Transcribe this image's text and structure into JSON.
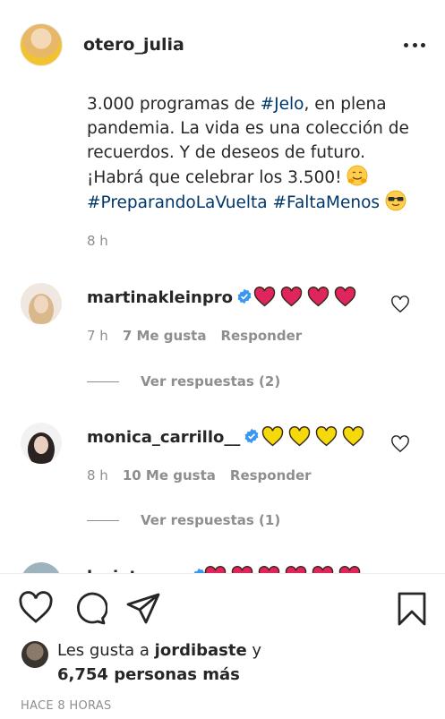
{
  "header": {
    "username": "otero_julia"
  },
  "caption": {
    "line1_text": "3.000 programas de ",
    "line1_tag": "#Jelo",
    "line1_rest": ", en plena",
    "line2": "pandemia. La vida es una colección de",
    "line3": "recuerdos. Y de deseos de futuro.",
    "line4": "¡Habrá que celebrar los 3.500! ",
    "line5_tag1": "#PreparandoLaVuelta",
    "line5_tag2": "#FaltaMenos",
    "time": "8 h"
  },
  "comments": [
    {
      "username": "martinakleinpro",
      "hearts": 4,
      "heart_color": "#e0245e",
      "time": "7 h",
      "likes": "7 Me gusta",
      "reply": "Responder",
      "view_replies": "Ver respuestas (2)"
    },
    {
      "username": "monica_carrillo__",
      "hearts": 4,
      "heart_color": "#f5d90a",
      "time": "8 h",
      "likes": "10 Me gusta",
      "reply": "Responder",
      "view_replies": "Ver respuestas (1)"
    },
    {
      "username": "lasiatrecea",
      "hearts": 6,
      "heart_color": "#e0245e"
    }
  ],
  "likes_summary": {
    "prefix": "Les gusta a ",
    "user": "jordibaste",
    "suffix": " y",
    "others": "6,754 personas más"
  },
  "timestamp": "HACE 8 HORAS",
  "colors": {
    "link": "#00376b",
    "muted": "#8e8e8e",
    "verified": "#3897f0"
  },
  "icons": [
    "more-options-icon",
    "verified-icon",
    "heart-icon",
    "comment-icon",
    "share-icon",
    "bookmark-icon"
  ]
}
